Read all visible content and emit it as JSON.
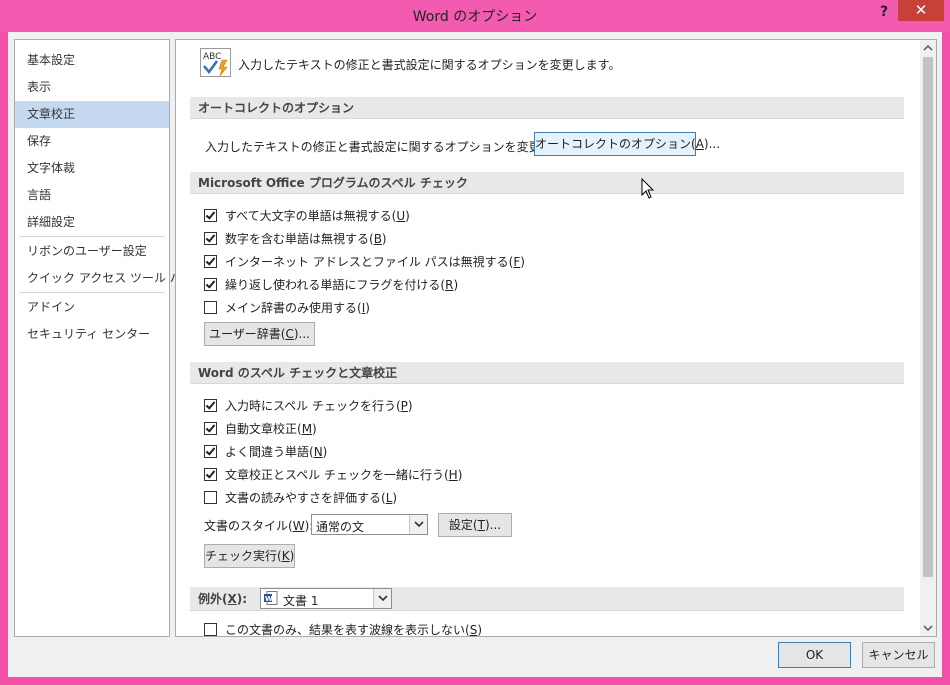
{
  "window": {
    "title": "Word のオプション",
    "help_glyph": "?",
    "close_glyph": "✕"
  },
  "sidebar": {
    "items": [
      {
        "label": "基本設定",
        "selected": false
      },
      {
        "label": "表示",
        "selected": false
      },
      {
        "label": "文章校正",
        "selected": true
      },
      {
        "label": "保存",
        "selected": false
      },
      {
        "label": "文字体裁",
        "selected": false
      },
      {
        "label": "言語",
        "selected": false
      },
      {
        "label": "詳細設定",
        "selected": false
      },
      {
        "label": "リボンのユーザー設定",
        "selected": false
      },
      {
        "label": "クイック アクセス ツール バー",
        "selected": false
      },
      {
        "label": "アドイン",
        "selected": false
      },
      {
        "label": "セキュリティ センター",
        "selected": false
      }
    ]
  },
  "content": {
    "intro": "入力したテキストの修正と書式設定に関するオプションを変更します。",
    "abc_icon_text": "ABC",
    "autocorrect": {
      "header": "オートコレクトのオプション",
      "description": "入力したテキストの修正と書式設定に関するオプションを変更します。",
      "button_text": "オートコレクトのオプション(",
      "button_key": "A",
      "button_suffix": ")..."
    },
    "office_spelling": {
      "header": "Microsoft Office プログラムのスペル チェック",
      "options": [
        {
          "label": "すべて大文字の単語は無視する(",
          "key": "U",
          "checked": true
        },
        {
          "label": "数字を含む単語は無視する(",
          "key": "B",
          "checked": true
        },
        {
          "label": "インターネット アドレスとファイル パスは無視する(",
          "key": "F",
          "checked": true
        },
        {
          "label": "繰り返し使われる単語にフラグを付ける(",
          "key": "R",
          "checked": true
        },
        {
          "label": "メイン辞書のみ使用する(",
          "key": "I",
          "checked": false
        }
      ],
      "dict_button_text": "ユーザー辞書(",
      "dict_button_key": "C",
      "dict_button_suffix": ")..."
    },
    "word_spelling": {
      "header": "Word のスペル チェックと文章校正",
      "options": [
        {
          "label": "入力時にスペル チェックを行う(",
          "key": "P",
          "checked": true
        },
        {
          "label": "自動文章校正(",
          "key": "M",
          "checked": true
        },
        {
          "label": "よく間違う単語(",
          "key": "N",
          "checked": true
        },
        {
          "label": "文章校正とスペル チェックを一緒に行う(",
          "key": "H",
          "checked": true
        },
        {
          "label": "文書の読みやすさを評価する(",
          "key": "L",
          "checked": false
        }
      ],
      "style_label": "文書のスタイル(",
      "style_key": "W",
      "style_suffix": "):",
      "style_value": "通常の文",
      "settings_button_text": "設定(",
      "settings_button_key": "T",
      "settings_button_suffix": ")...",
      "check_button_text": "チェック実行(",
      "check_button_key": "K",
      "check_button_suffix": ")"
    },
    "exceptions": {
      "label": "例外(",
      "key": "X",
      "suffix": "):",
      "document_value": "文書 1",
      "option": {
        "label": "この文書のみ、結果を表す波線を表示しない(",
        "key": "S",
        "checked": false
      }
    }
  },
  "footer": {
    "ok_label": "OK",
    "cancel_label": "キャンセル"
  },
  "colors": {
    "titlebar": "#f35bb1",
    "close_button": "#c7403a",
    "selected_nav": "#c5daf0",
    "hot_button": "#e5f1fb"
  }
}
